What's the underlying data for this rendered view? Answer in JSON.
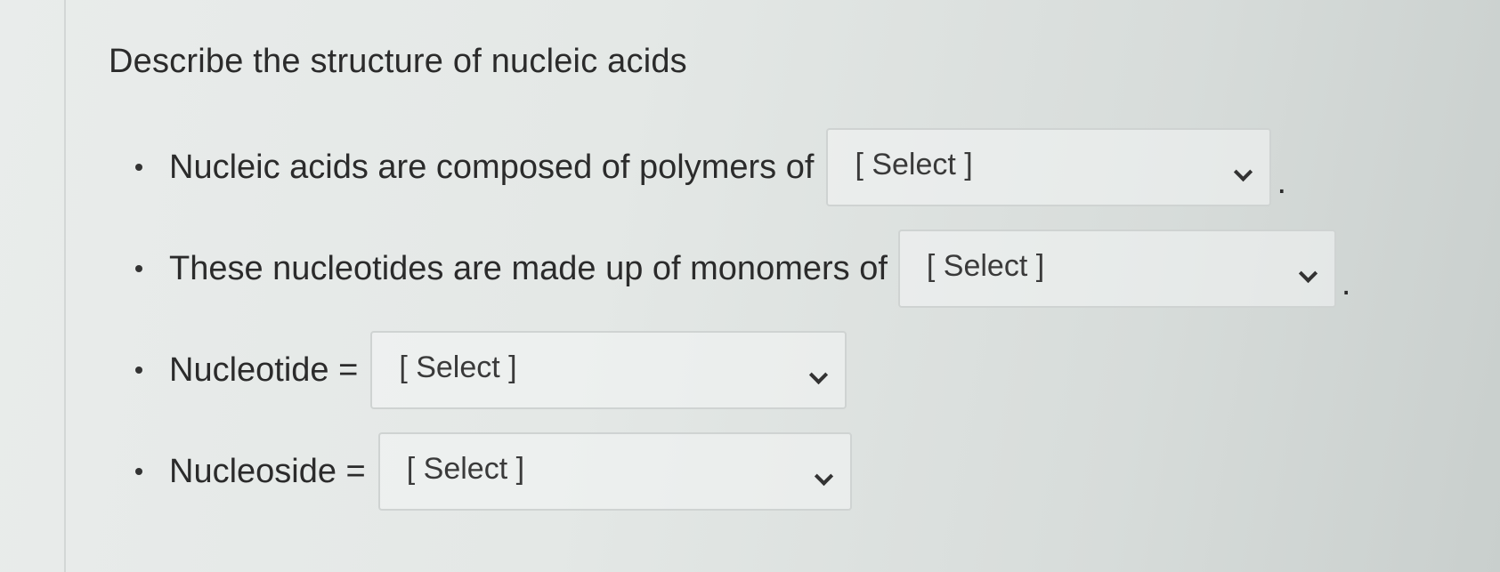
{
  "question": {
    "title": "Describe the structure of nucleic acids",
    "items": [
      {
        "text": "Nucleic acids are composed of polymers of",
        "select_value": "[ Select ]",
        "trailing": "."
      },
      {
        "text": "These nucleotides are made up of monomers of",
        "select_value": "[ Select ]",
        "trailing": "."
      },
      {
        "text": "Nucleotide =",
        "select_value": "[ Select ]",
        "trailing": ""
      },
      {
        "text": "Nucleoside =",
        "select_value": "[ Select ]",
        "trailing": ""
      }
    ]
  },
  "icons": {
    "dropdown": "chevron-down-icon"
  }
}
